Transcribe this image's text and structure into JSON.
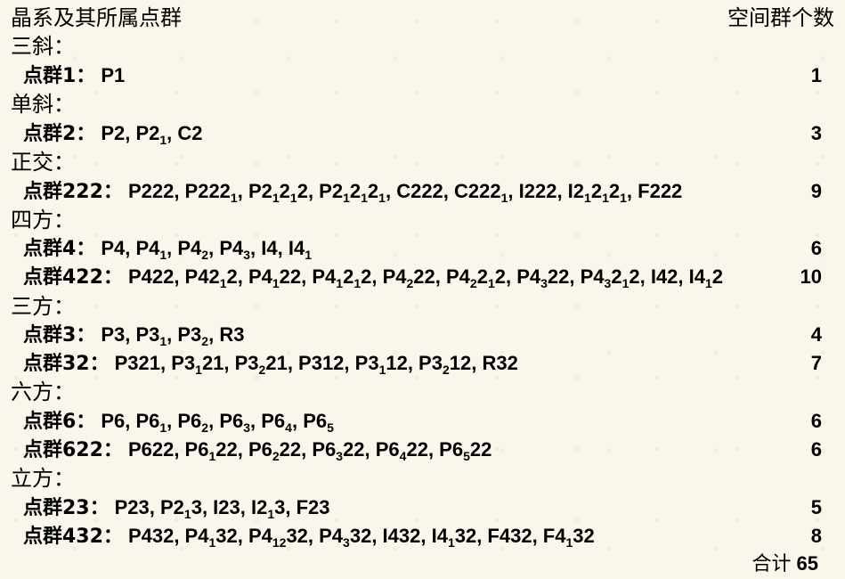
{
  "header": {
    "left": "晶系及其所属点群",
    "right": "空间群个数"
  },
  "systems": {
    "triclinic": {
      "title": "三斜：",
      "pg1": {
        "label": "点群1：",
        "groups": "P1",
        "count": "1"
      }
    },
    "monoclinic": {
      "title": "单斜：",
      "pg2": {
        "label": "点群2：",
        "groups": "P2, P2₁, C2",
        "count": "3"
      }
    },
    "orthorhombic": {
      "title": "正交：",
      "pg222": {
        "label": "点群222：",
        "groups": "P222, P222₁, P2₁2₁2, P2₁2₁2₁, C222, C222₁, I222, I2₁2₁2₁, F222",
        "count": "9"
      }
    },
    "tetragonal": {
      "title": "四方：",
      "pg4": {
        "label": "点群4：",
        "groups": "P4, P4₁, P4₂, P4₃, I4, I4₁",
        "count": "6"
      },
      "pg422": {
        "label": "点群422：",
        "groups": "P422, P42₁2, P4₁22, P4₁2₁2, P4₂22, P4₂2₁2, P4₃22, P4₃2₁2, I42, I4₁2",
        "count": "10"
      }
    },
    "trigonal": {
      "title": "三方：",
      "pg3": {
        "label": "点群3：",
        "groups": "P3, P3₁, P3₂, R3",
        "count": "4"
      },
      "pg32": {
        "label": "点群32：",
        "groups": "P321, P3₁21, P3₂21, P312, P3₁12, P3₂12, R32",
        "count": "7"
      }
    },
    "hexagonal": {
      "title": "六方：",
      "pg6": {
        "label": "点群6：",
        "groups": "P6, P6₁, P6₂, P6₃, P6₄, P6₅",
        "count": "6"
      },
      "pg622": {
        "label": "点群622：",
        "groups": "P622, P6₁22, P6₂22, P6₃22, P6₄22, P6₅22",
        "count": "6"
      }
    },
    "cubic": {
      "title": "立方：",
      "pg23": {
        "label": "点群23：",
        "groups": "P23, P2₁3, I23, I2₁3, F23",
        "count": "5"
      },
      "pg432": {
        "label": "点群432：",
        "groups": "P432, P4₁32, P4₁₂32, P4₃32, I432, I4₁32, F432, F4₁32",
        "count": "8"
      }
    }
  },
  "total": {
    "label": "合计",
    "value": "65"
  }
}
